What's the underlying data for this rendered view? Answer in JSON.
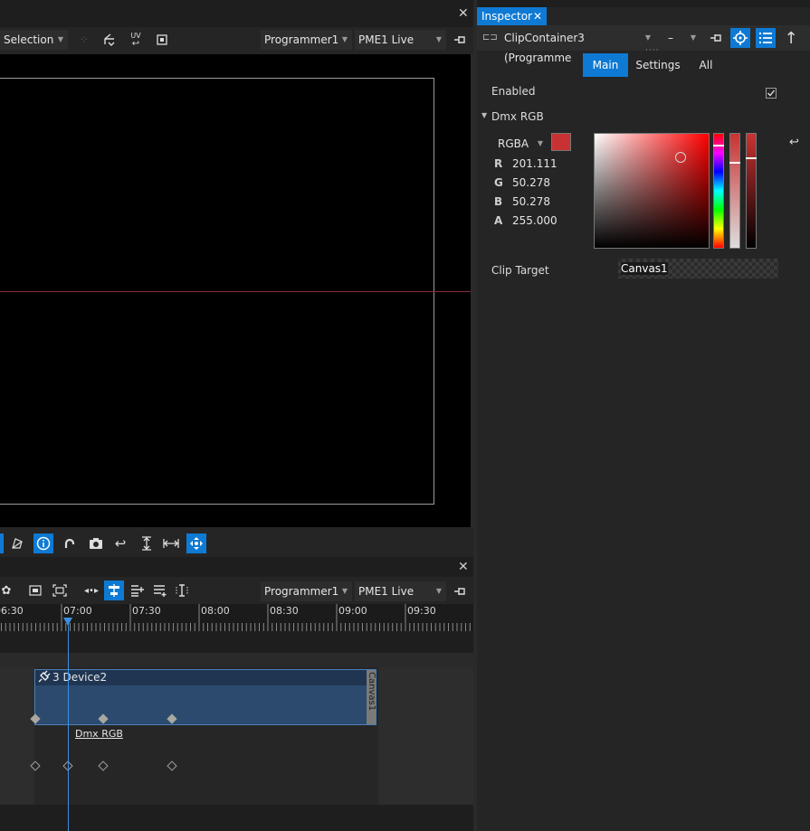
{
  "viewport": {
    "selection_label": "Selection",
    "programmer_label": "Programmer1",
    "live_label": "PME1 Live",
    "uv_label": "UV"
  },
  "timeline": {
    "programmer_label": "Programmer1",
    "live_label": "PME1 Live",
    "ruler": [
      "06:30",
      "07:00",
      "07:30",
      "08:00",
      "08:30",
      "09:00",
      "09:30"
    ],
    "clip": {
      "title": "3 Device2",
      "side_label": "Canvas1",
      "track_label": "Dmx RGB"
    }
  },
  "inspector": {
    "tab_title": "Inspector",
    "object_label": "ClipContainer3 (Programme",
    "zoom_label": "–",
    "tabs": [
      {
        "label": "Main",
        "active": true
      },
      {
        "label": "Settings",
        "active": false
      },
      {
        "label": "All",
        "active": false
      }
    ],
    "enabled_label": "Enabled",
    "enabled_checked": true,
    "section_title": "Dmx RGB",
    "mode_label": "RGBA",
    "channels": [
      {
        "name": "R",
        "value": "201.111"
      },
      {
        "name": "G",
        "value": "50.278"
      },
      {
        "name": "B",
        "value": "50.278"
      },
      {
        "name": "A",
        "value": "255.000"
      }
    ],
    "swatch_color": "#c93232",
    "clip_target_label": "Clip Target",
    "clip_target_value": "Canvas1"
  },
  "colors": {
    "accent": "#0e7ad4",
    "panel": "#1e1e1e",
    "toolbar": "#2d2d2d",
    "clip_fill": "#2c4a6e"
  }
}
